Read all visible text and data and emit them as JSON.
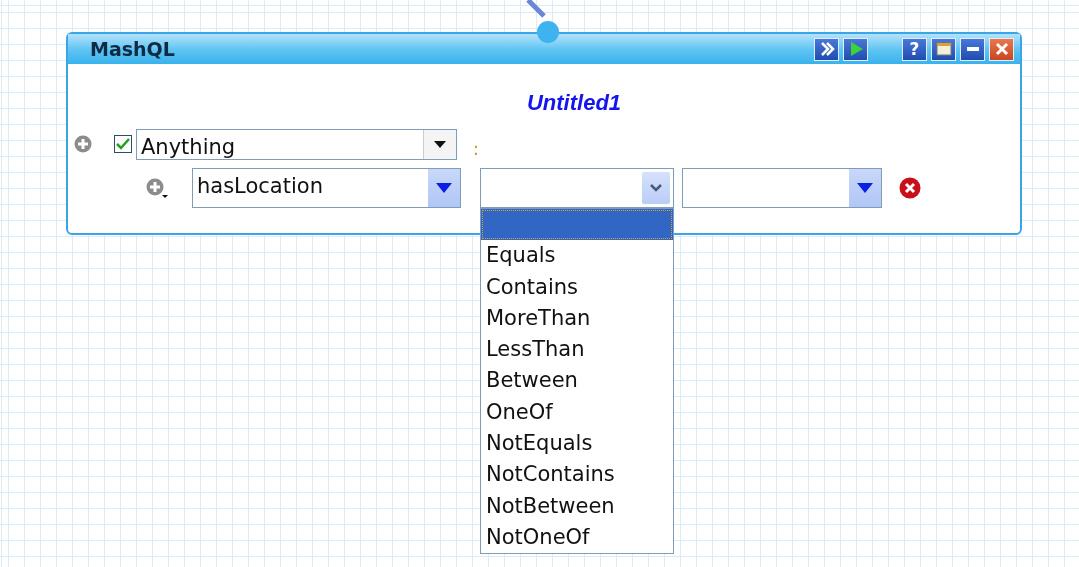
{
  "window": {
    "title": "MashQL",
    "help_label": "?"
  },
  "query": {
    "title": "Untitled1"
  },
  "subject": {
    "checked": true,
    "value": "Anything",
    "separator": ":"
  },
  "restriction": {
    "property": "hasLocation",
    "operator": {
      "expanded": true,
      "options": [
        {
          "selected": true
        },
        {
          "label": "Equals",
          "selected": false
        },
        {
          "label": "Contains",
          "selected": false
        },
        {
          "label": "MoreThan",
          "selected": false
        },
        {
          "label": "LessThan",
          "selected": false
        },
        {
          "label": "Between",
          "selected": false
        },
        {
          "label": "OneOf",
          "selected": false
        },
        {
          "label": "NotEquals",
          "selected": false
        },
        {
          "label": "NotContains",
          "selected": false
        },
        {
          "label": "NotBetween",
          "selected": false
        },
        {
          "label": "NotOneOf",
          "selected": false
        }
      ]
    }
  }
}
